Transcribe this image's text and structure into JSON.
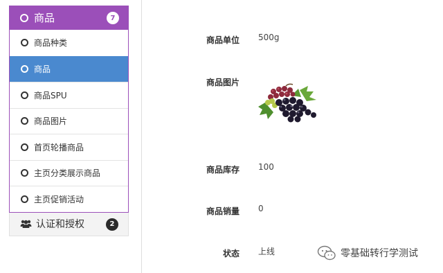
{
  "sidebar": {
    "group_title": "商品",
    "group_badge": "7",
    "items": [
      {
        "label": "商品种类"
      },
      {
        "label": "商品"
      },
      {
        "label": "商品SPU"
      },
      {
        "label": "商品图片"
      },
      {
        "label": "首页轮播商品"
      },
      {
        "label": "主页分类展示商品"
      },
      {
        "label": "主页促销活动"
      }
    ],
    "group2_title": "认证和授权",
    "group2_badge": "2"
  },
  "detail": {
    "unit_label": "商品单位",
    "unit_value": "500g",
    "image_label": "商品图片",
    "stock_label": "商品库存",
    "stock_value": "100",
    "sales_label": "商品销量",
    "sales_value": "0",
    "status_label": "状态",
    "status_value": "上线"
  },
  "watermark": {
    "text": "零基础转行学测试"
  },
  "colors": {
    "menu_purple": "#9b4fb9",
    "active_blue": "#4a89cf"
  },
  "icons": [
    "circle-outline-icon",
    "users-icon",
    "wechat-icon"
  ]
}
